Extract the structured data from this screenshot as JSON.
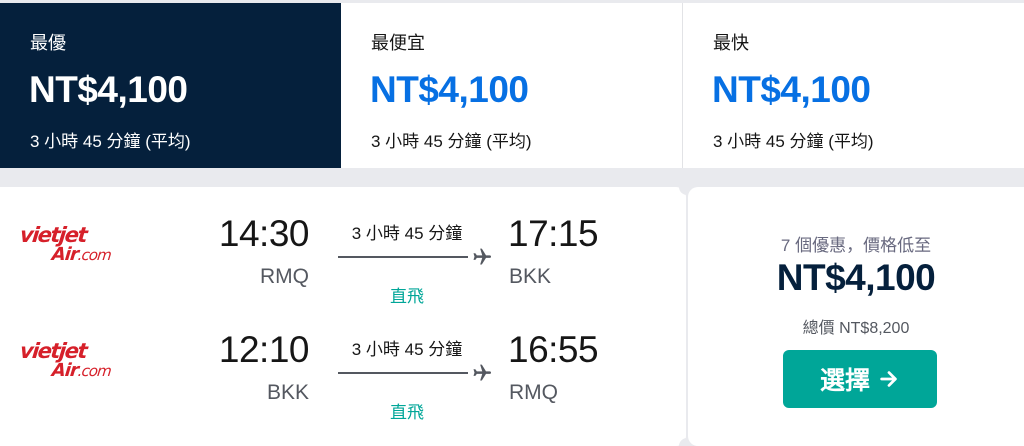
{
  "sort_tabs": [
    {
      "label": "最優",
      "price": "NT$4,100",
      "duration": "3 小時 45 分鐘 (平均)"
    },
    {
      "label": "最便宜",
      "price": "NT$4,100",
      "duration": "3 小時 45 分鐘 (平均)"
    },
    {
      "label": "最快",
      "price": "NT$4,100",
      "duration": "3 小時 45 分鐘 (平均)"
    }
  ],
  "result": {
    "legs": [
      {
        "airline": {
          "line1": "vietjet",
          "line2": "Air",
          "suffix": ".com"
        },
        "dep_time": "14:30",
        "dep_code": "RMQ",
        "duration": "3 小時 45 分鐘",
        "stops": "直飛",
        "arr_time": "17:15",
        "arr_code": "BKK"
      },
      {
        "airline": {
          "line1": "vietjet",
          "line2": "Air",
          "suffix": ".com"
        },
        "dep_time": "12:10",
        "dep_code": "BKK",
        "duration": "3 小時 45 分鐘",
        "stops": "直飛",
        "arr_time": "16:55",
        "arr_code": "RMQ"
      }
    ],
    "deals_text": "7 個優惠，價格低至",
    "price": "NT$4,100",
    "total": "總價 NT$8,200",
    "select_label": "選擇"
  },
  "icons": {
    "plane": "plane-icon",
    "arrow": "arrow-right-icon"
  },
  "colors": {
    "navy": "#05203c",
    "blue": "#0770e3",
    "teal": "#00a698",
    "brand_red": "#d6202a"
  }
}
